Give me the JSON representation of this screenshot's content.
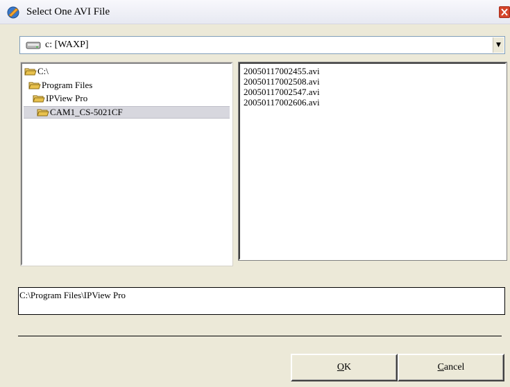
{
  "window": {
    "title": "Select One AVI File"
  },
  "drive": {
    "selected": "c: [WAXP]"
  },
  "directories": [
    {
      "label": "C:\\",
      "selected": false
    },
    {
      "label": "Program Files",
      "selected": false
    },
    {
      "label": "IPView Pro",
      "selected": false
    },
    {
      "label": "CAM1_CS-5021CF",
      "selected": true
    }
  ],
  "files": [
    "20050117002455.avi",
    "20050117002508.avi",
    "20050117002547.avi",
    "20050117002606.avi"
  ],
  "path": {
    "value": "C:\\Program Files\\IPView Pro"
  },
  "buttons": {
    "ok_mnemonic": "O",
    "ok_rest": "K",
    "cancel_mnemonic": "C",
    "cancel_rest": "ancel"
  },
  "icons": {
    "app": "app-icon",
    "close": "close-icon",
    "drive": "drive-icon",
    "folder": "folder-open-icon",
    "dropdown": "chevron-down-icon"
  },
  "colors": {
    "close_button": "#d5452a",
    "selection": "#d7d7de",
    "folder": "#e8c14d"
  }
}
